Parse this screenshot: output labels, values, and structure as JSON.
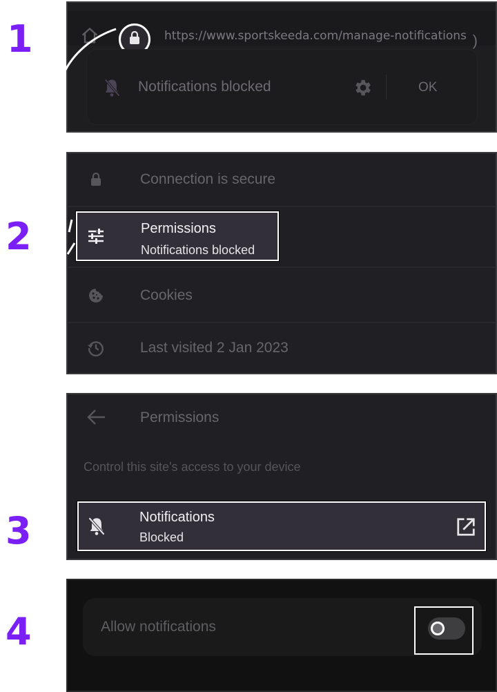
{
  "steps": [
    "1",
    "2",
    "3",
    "4"
  ],
  "step1": {
    "url": "https://www.sportskeeda.com/manage-notifications",
    "home_icon": "home-icon",
    "lock_icon": "lock-icon",
    "popup": {
      "message": "Notifications blocked",
      "icon": "bell-off-icon",
      "settings_icon": "gear-icon",
      "ok_label": "OK",
      "trailing": ")"
    }
  },
  "step2": {
    "items": [
      {
        "icon": "lock-icon",
        "label": "Connection is secure"
      },
      {
        "icon": "sliders-icon",
        "label": "Permissions",
        "sublabel": "Notifications blocked",
        "highlighted": true
      },
      {
        "icon": "cookie-icon",
        "label": "Cookies"
      },
      {
        "icon": "history-icon",
        "label": "Last visited 2 Jan 2023"
      }
    ]
  },
  "step3": {
    "back_icon": "arrow-left-icon",
    "title": "Permissions",
    "description": "Control this site's access to your device",
    "item": {
      "icon": "bell-off-icon",
      "label": "Notifications",
      "sublabel": "Blocked",
      "action_icon": "open-external-icon"
    }
  },
  "step4": {
    "label": "Allow notifications",
    "toggle_on": false
  },
  "colors": {
    "step_number": "#7a1ff5",
    "highlight_border": "#ffffff"
  }
}
